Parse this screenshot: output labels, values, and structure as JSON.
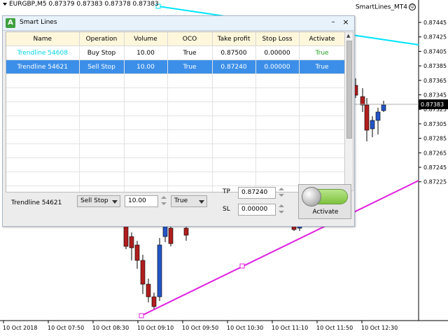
{
  "chart": {
    "symbol_info": "EURGBP,M5  0.87379 0.87383 0.87378 0.87383",
    "ea_name": "SmartLines_MT4",
    "current_price": "0.87383",
    "price_axis": [
      "0.87445",
      "0.87425",
      "0.87405",
      "0.87385",
      "0.87365",
      "0.87345",
      "0.87325",
      "0.87305",
      "0.87285",
      "0.87265",
      "0.87245",
      "0.87225"
    ],
    "time_axis": [
      "10 Oct 2018",
      "10 Oct 07:50",
      "10 Oct 08:30",
      "10 Oct 09:10",
      "10 Oct 09:50",
      "10 Oct 10:30",
      "10 Oct 11:10",
      "10 Oct 11:50",
      "10 Oct 12:30"
    ],
    "colors": {
      "up_candle": "#2355c8",
      "down_candle": "#b01e1e",
      "cyan_line": "#00e5ff",
      "magenta_line": "#e020e0"
    }
  },
  "panel": {
    "title": "Smart Lines",
    "icon_letter": "A",
    "minimize_glyph": "–",
    "close_glyph": "×",
    "columns": [
      "Name",
      "Operation",
      "Volume",
      "OCO",
      "Take profit",
      "Stop Loss",
      "Activate"
    ],
    "rows": [
      {
        "name": "Trendline 54608",
        "operation": "Buy Stop",
        "volume": "10.00",
        "oco": "True",
        "take_profit": "0.87500",
        "stop_loss": "0.00000",
        "activate": "True"
      },
      {
        "name": "Trendline 54621",
        "operation": "Sell Stop",
        "volume": "10.00",
        "oco": "True",
        "take_profit": "0.87240",
        "stop_loss": "0.00000",
        "activate": "True"
      }
    ],
    "editor": {
      "name": "Trendline 54621",
      "operation": "Sell Stop",
      "volume": "10.00",
      "oco": "True",
      "tp_label": "TP",
      "tp_value": "0.87240",
      "sl_label": "SL",
      "sl_value": "0.00000",
      "activate_label": "Activate"
    }
  }
}
